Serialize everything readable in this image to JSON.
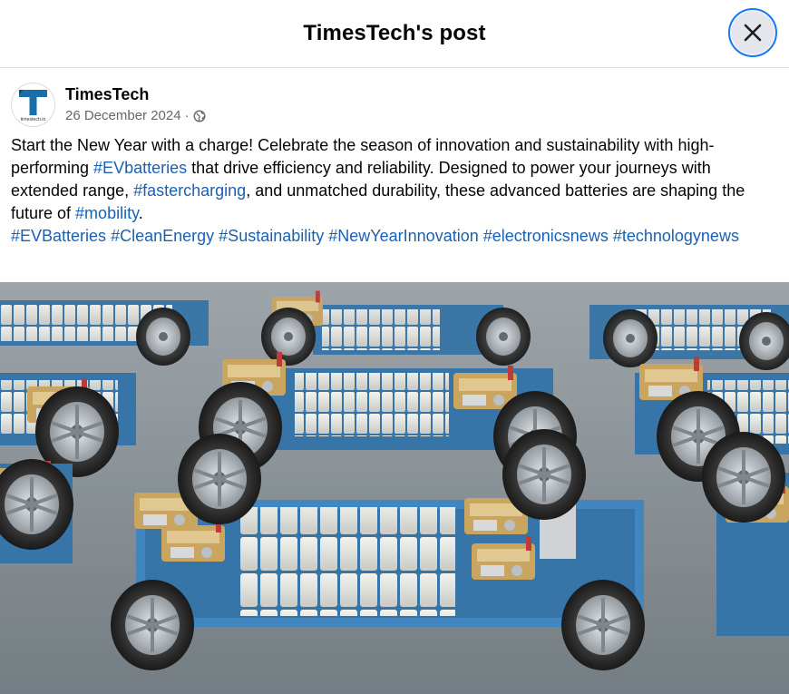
{
  "modal": {
    "title": "TimesTech's post"
  },
  "post": {
    "author": "TimesTech",
    "avatar_text": "timestech.in",
    "date": "26 December 2024",
    "separator": "·",
    "privacy_icon": "globe-icon",
    "body": {
      "t1": "Start the New Year with a charge! Celebrate the season of innovation and sustainability with high-performing ",
      "h1": "#EVbatteries",
      "t2": " that drive efficiency and reliability. Designed to power your journeys with extended range, ",
      "h2": "#fastercharging",
      "t3": ", and unmatched durability, these advanced batteries are shaping the future of ",
      "h3": "#mobility",
      "t4": "."
    },
    "hashtags": [
      "#EVBatteries",
      "#CleanEnergy",
      "#Sustainability",
      "#NewYearInnovation",
      "#electronicsnews",
      "#technologynews"
    ]
  },
  "colors": {
    "hashtag": "#1a61b4",
    "close_ring": "#1877f2",
    "brand": "#1b6fa8"
  },
  "icons": {
    "close": "close-icon",
    "globe": "globe-icon"
  }
}
